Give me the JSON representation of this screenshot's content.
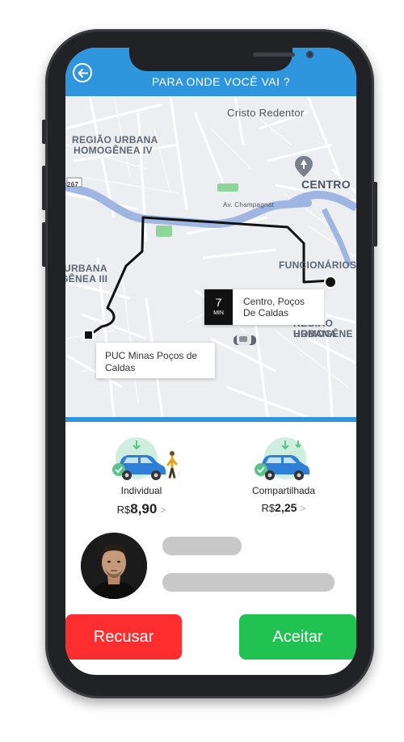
{
  "header": {
    "title": "PARA ONDE VOCÊ VAI ?"
  },
  "map": {
    "labels": {
      "landmark": "Cristo Redentor",
      "region_1": "REGIÃO URBANA",
      "region_1b": "HOMOGÊNEA IV",
      "centro": "CENTRO",
      "avenue": "Av. Champagnat",
      "road_number": "267",
      "region_2": "URBANA",
      "region_2b": "GÊNEA III",
      "funcionarios": "FUNCIONÁRIOS",
      "region_3": "REGIÃO URBANA",
      "region_3b": "HOMOGÊNE"
    },
    "destination": {
      "minutes": "7",
      "unit": "MIN",
      "line1": "Centro, Poços",
      "line2": "De Caldas"
    },
    "origin": {
      "line1": "PUC Minas Poços de",
      "line2": "Caldas"
    }
  },
  "options": [
    {
      "label": "Individual",
      "currency": "R$",
      "price": "8,90"
    },
    {
      "label": "Compartilhada",
      "currency": "R$",
      "price": "2,25"
    }
  ],
  "actions": {
    "decline": "Recusar",
    "accept": "Aceitar"
  },
  "colors": {
    "primary": "#2f95dc",
    "decline": "#ff2e2e",
    "accept": "#21c152",
    "route": "#111111"
  }
}
